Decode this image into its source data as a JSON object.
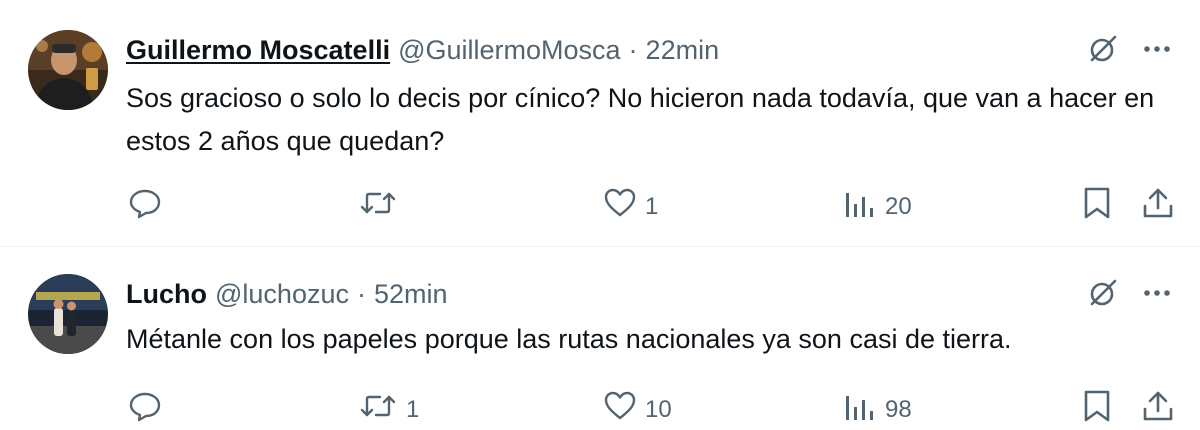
{
  "tweets": [
    {
      "display_name": "Guillermo Moscatelli",
      "handle": "@GuillermoMosca",
      "separator": "·",
      "time": "22min",
      "text": "Sos gracioso o solo lo decis por cínico? No hicieron nada todavía, que van a hacer en estos 2 años que quedan?",
      "retweets": "",
      "likes": "1",
      "views": "20"
    },
    {
      "display_name": "Lucho",
      "handle": "@luchozuc",
      "separator": "·",
      "time": "52min",
      "text": "Métanle con los papeles porque las rutas nacionales ya son casi de tierra.",
      "retweets": "1",
      "likes": "10",
      "views": "98"
    }
  ],
  "colors": {
    "text": "#0f1419",
    "secondary": "#536471",
    "divider": "#eff3f4"
  },
  "icons": [
    "grok-icon",
    "more-icon",
    "reply-icon",
    "retweet-icon",
    "like-icon",
    "views-icon",
    "bookmark-icon",
    "share-icon"
  ]
}
